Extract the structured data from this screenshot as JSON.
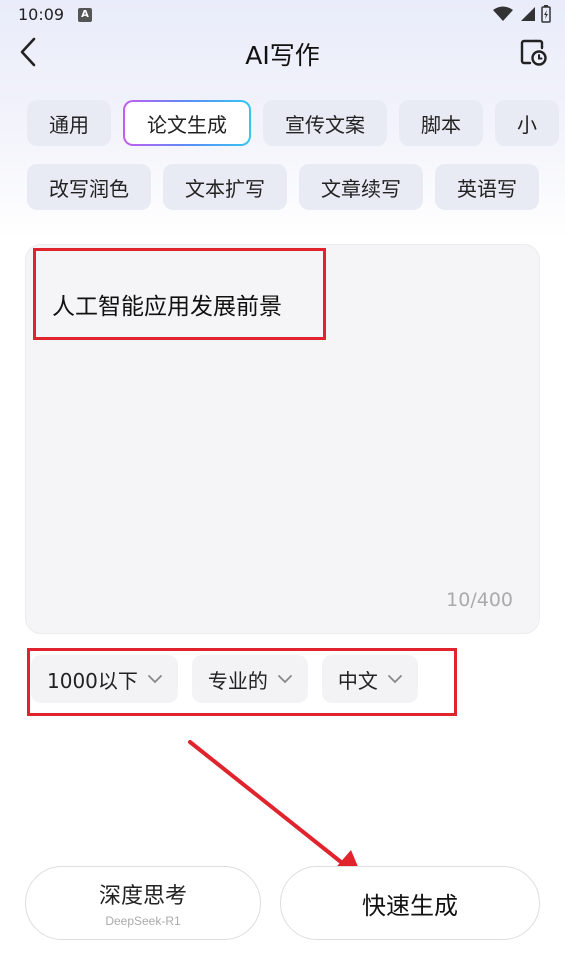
{
  "status": {
    "time": "10:09",
    "notification_glyph": "A"
  },
  "header": {
    "title": "AI写作",
    "back_icon": "chevron-left-icon",
    "history_icon": "history-doc-icon"
  },
  "categories_row1": [
    "通用",
    "论文生成",
    "宣传文案",
    "脚本",
    "小"
  ],
  "categories_row2": [
    "改写润色",
    "文本扩写",
    "文章续写",
    "英语写"
  ],
  "active_category": "论文生成",
  "editor": {
    "text": "人工智能应用发展前景",
    "count": "10/400"
  },
  "options": {
    "length": "1000以下",
    "tone": "专业的",
    "language": "中文"
  },
  "buttons": {
    "deep_think": "深度思考",
    "deep_think_sub": "DeepSeek-R1",
    "fast_generate": "快速生成"
  },
  "colors": {
    "annotation": "#e0232d",
    "accent_gradient": [
      "#c45cf0",
      "#5b8cf7",
      "#35c6f0"
    ]
  }
}
